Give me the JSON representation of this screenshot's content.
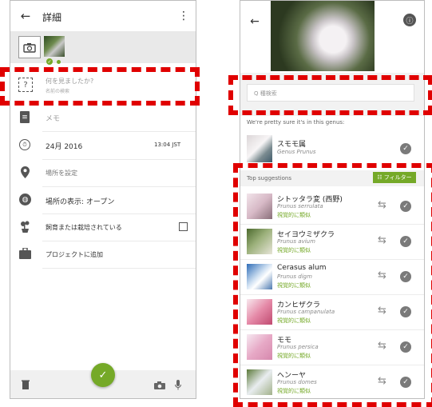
{
  "left": {
    "header": {
      "title": "詳細"
    },
    "rows": [
      {
        "id": "id-prompt",
        "label": "何を見ましたか?",
        "sub": "名前の検索"
      },
      {
        "id": "notes",
        "label": "メモ"
      },
      {
        "id": "date",
        "label": "24月 2016",
        "value": "13:04 JST"
      },
      {
        "id": "location",
        "label": "場所を設定"
      },
      {
        "id": "geoprivacy",
        "label": "場所の表示: オープン"
      },
      {
        "id": "captive",
        "label": "飼育または栽培されている"
      },
      {
        "id": "project",
        "label": "プロジェクトに追加"
      }
    ],
    "fab_icon": "check-icon"
  },
  "right": {
    "search": {
      "placeholder": "Q 種検索"
    },
    "pretty_sure": "We're pretty sure it's in this genus:",
    "genus": {
      "name": "スモモ属",
      "sci": "Genus Prunus"
    },
    "top_label": "Top suggestions",
    "filter_label": "フィルター",
    "suggestions": [
      {
        "name": "シトッタラ変 (西野)",
        "sci": "Prunus serrulata",
        "tag": "視覚的に類似"
      },
      {
        "name": "セイヨウミザクラ",
        "sci": "Prunus avium",
        "tag": "視覚的に類似"
      },
      {
        "name": "Cerasus alum",
        "sci": "Prunus digm",
        "tag": "視覚的に類似"
      },
      {
        "name": "カンヒザクラ",
        "sci": "Prunus campanulata",
        "tag": "視覚的に類似"
      },
      {
        "name": "モモ",
        "sci": "Prunus persica",
        "tag": "視覚的に類似"
      },
      {
        "name": "ヘンーヤ",
        "sci": "Prunus domes",
        "tag": "視覚的に類似"
      }
    ]
  },
  "colors": {
    "accent_green": "#75a928",
    "highlight_red": "#e00000"
  }
}
